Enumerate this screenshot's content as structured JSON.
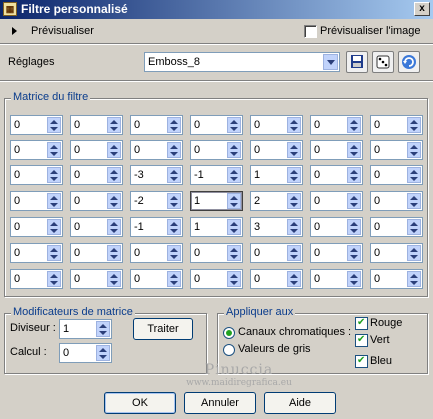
{
  "window": {
    "title": "Filtre personnalisé",
    "close_label": "x"
  },
  "preview": {
    "label": "Prévisualiser",
    "image_checkbox_label": "Prévisualiser l'image",
    "image_checked": false
  },
  "settings": {
    "label": "Réglages",
    "selected": "Emboss_8"
  },
  "matrix": {
    "title": "Matrice du filtre",
    "rows": [
      [
        "0",
        "0",
        "0",
        "0",
        "0",
        "0",
        "0"
      ],
      [
        "0",
        "0",
        "0",
        "0",
        "0",
        "0",
        "0"
      ],
      [
        "0",
        "0",
        "-3",
        "-1",
        "1",
        "0",
        "0"
      ],
      [
        "0",
        "0",
        "-2",
        "1",
        "2",
        "0",
        "0"
      ],
      [
        "0",
        "0",
        "-1",
        "1",
        "3",
        "0",
        "0"
      ],
      [
        "0",
        "0",
        "0",
        "0",
        "0",
        "0",
        "0"
      ],
      [
        "0",
        "0",
        "0",
        "0",
        "0",
        "0",
        "0"
      ]
    ]
  },
  "modifiers": {
    "title": "Modificateurs de matrice",
    "divisor_label": "Diviseur :",
    "divisor_value": "1",
    "calc_label": "Calcul :",
    "calc_value": "0",
    "compute_button": "Traiter"
  },
  "apply": {
    "title": "Appliquer aux",
    "channels_label": "Canaux chromatiques :",
    "gray_label": "Valeurs de gris",
    "channels_selected": true,
    "red_label": "Rouge",
    "green_label": "Vert",
    "blue_label": "Bleu",
    "red_checked": true,
    "green_checked": true,
    "blue_checked": true
  },
  "watermark": {
    "line1": "Pinuccia",
    "line2": "www.maidiregrafica.eu"
  },
  "buttons": {
    "ok": "OK",
    "cancel": "Annuler",
    "help": "Aide"
  }
}
